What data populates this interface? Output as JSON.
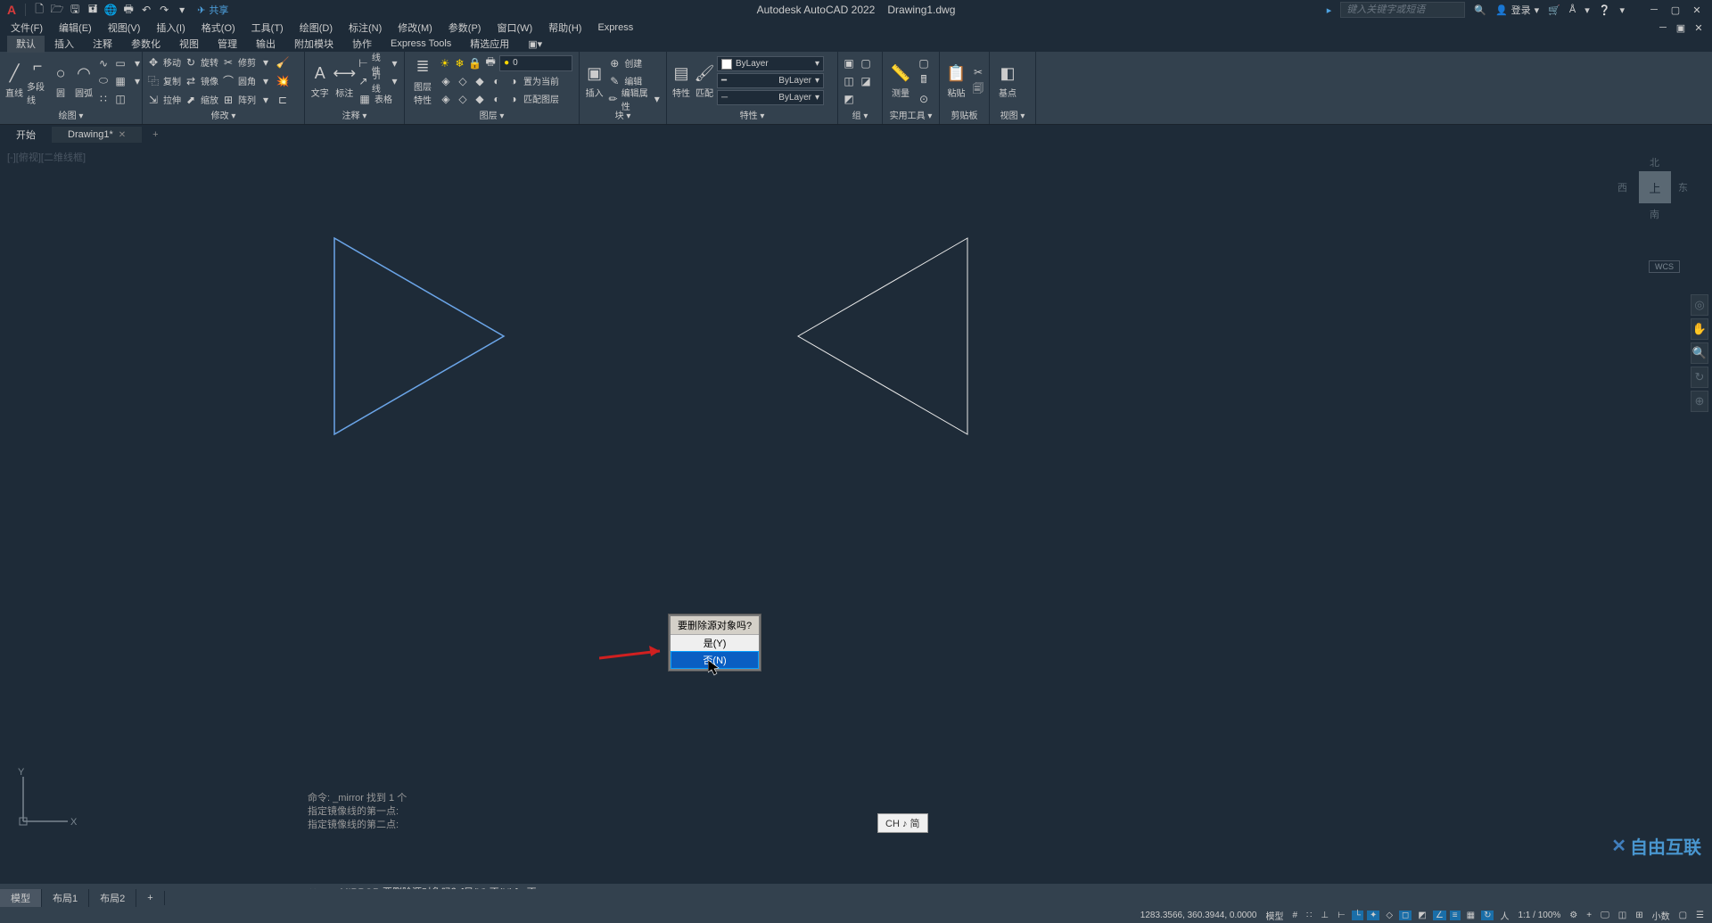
{
  "title": {
    "app": "Autodesk AutoCAD 2022",
    "file": "Drawing1.dwg",
    "share": "共享"
  },
  "search": {
    "placeholder": "键入关键字或短语",
    "login": "登录"
  },
  "menu": [
    "文件(F)",
    "编辑(E)",
    "视图(V)",
    "插入(I)",
    "格式(O)",
    "工具(T)",
    "绘图(D)",
    "标注(N)",
    "修改(M)",
    "参数(P)",
    "窗口(W)",
    "帮助(H)",
    "Express"
  ],
  "rtabs": [
    "默认",
    "插入",
    "注释",
    "参数化",
    "视图",
    "管理",
    "输出",
    "附加模块",
    "协作",
    "Express Tools",
    "精选应用"
  ],
  "panels": {
    "draw": {
      "title": "绘图 ▾",
      "items": [
        "直线",
        "多段线",
        "圆",
        "圆弧"
      ]
    },
    "modify": {
      "title": "修改 ▾",
      "move": "移动",
      "rotate": "旋转",
      "trim": "修剪",
      "copy": "复制",
      "mirror": "镜像",
      "fillet": "圆角",
      "stretch": "拉伸",
      "scale": "缩放",
      "array": "阵列"
    },
    "annot": {
      "title": "注释 ▾",
      "text": "文字",
      "dim": "标注",
      "line": "线性",
      "leader": "引线",
      "table": "表格"
    },
    "layer": {
      "title": "图层 ▾",
      "prop": "图层\n特性",
      "current": "0",
      "setcur": "置为当前",
      "match": "匹配图层"
    },
    "block": {
      "title": "块 ▾",
      "insert": "插入",
      "create": "创建",
      "edit": "编辑",
      "attr": "编辑属性"
    },
    "props": {
      "title": "特性 ▾",
      "prop": "特性",
      "match": "匹配",
      "bylayer": "ByLayer"
    },
    "group": {
      "title": "组 ▾"
    },
    "util": {
      "title": "实用工具 ▾",
      "measure": "测量"
    },
    "clip": {
      "title": "剪贴板",
      "paste": "粘贴"
    },
    "view": {
      "title": "视图 ▾",
      "base": "基点"
    }
  },
  "ftabs": {
    "start": "开始",
    "drawing": "Drawing1*"
  },
  "viewport": "[-][俯视][二维线框]",
  "viewcube": {
    "n": "北",
    "s": "南",
    "e": "东",
    "w": "西",
    "top": "上"
  },
  "wcs": "WCS",
  "prompt": {
    "title": "要删除源对象吗?",
    "yes": "是(Y)",
    "no": "否(N)"
  },
  "ime": "CH ♪ 简",
  "cmdhist": [
    "命令: _mirror 找到 1 个",
    "指定镜像线的第一点:",
    "指定镜像线的第二点:"
  ],
  "cmdline": {
    "prefix": "▸ ▾",
    "text": "MIRROR 要删除源对象吗？[是(Y) 否(N) ] <否>:"
  },
  "ltabs": [
    "模型",
    "布局1",
    "布局2"
  ],
  "status": {
    "coords": "1283.3566, 360.3944, 0.0000",
    "model": "模型",
    "scale": "1:1 / 100%",
    "dec": "小数"
  },
  "watermark": "自由互联"
}
